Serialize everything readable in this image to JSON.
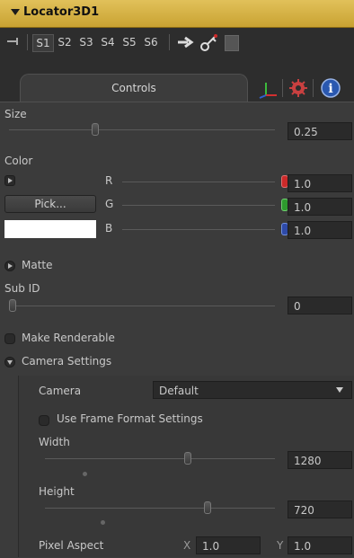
{
  "header": {
    "title": "Locator3D1"
  },
  "toolbar": {
    "subviews": [
      "S1",
      "S2",
      "S3",
      "S4",
      "S5",
      "S6"
    ],
    "active": "S1"
  },
  "tabs": [
    {
      "label": "Controls",
      "active": true
    },
    {
      "icon": "axis-icon"
    },
    {
      "icon": "gear-icon"
    },
    {
      "icon": "info-icon"
    }
  ],
  "size": {
    "label": "Size",
    "value": "0.25",
    "slider_fraction": 0.25
  },
  "color": {
    "label": "Color",
    "pick_label": "Pick...",
    "swatch": "#ffffff",
    "channels": [
      {
        "name": "R",
        "value": "1.0",
        "color": "#cc2a2a"
      },
      {
        "name": "G",
        "value": "1.0",
        "color": "#2e9a2e"
      },
      {
        "name": "B",
        "value": "1.0",
        "color": "#2e4aa8"
      }
    ]
  },
  "matte": {
    "label": "Matte"
  },
  "sub_id": {
    "label": "Sub ID",
    "value": "0"
  },
  "make_renderable": {
    "label": "Make Renderable"
  },
  "camera_settings": {
    "label": "Camera Settings",
    "camera_label": "Camera",
    "camera_value": "Default",
    "use_frame_format": "Use Frame Format Settings",
    "width_label": "Width",
    "width_value": "1280",
    "height_label": "Height",
    "height_value": "720",
    "pixel_aspect_label": "Pixel Aspect",
    "x_label": "X",
    "x_value": "1.0",
    "y_label": "Y",
    "y_value": "1.0"
  }
}
